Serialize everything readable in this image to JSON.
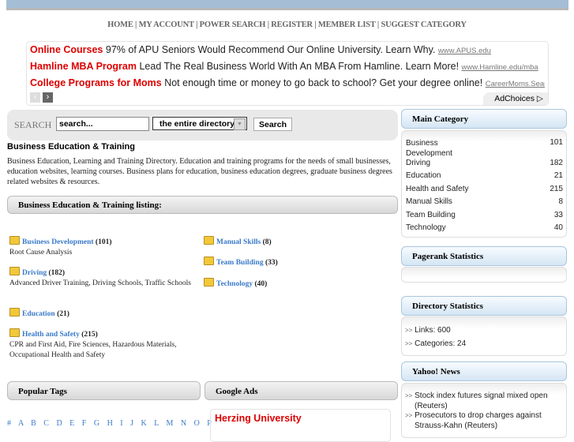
{
  "nav": [
    "HOME",
    "MY ACCOUNT",
    "POWER SEARCH",
    "REGISTER",
    "MEMBER LIST",
    "SUGGEST CATEGORY"
  ],
  "ads": [
    {
      "title": "Online Courses",
      "text": "97% of APU Seniors Would Recommend Our Online University. Learn Why.",
      "url": "www.APUS.edu"
    },
    {
      "title": "Hamline MBA Program",
      "text": "Lead The Real Business World With An MBA From Hamline. Learn More!",
      "url": "www.Hamline.edu/mba"
    },
    {
      "title": "College Programs for Moms",
      "text": "Not enough time or money to go back to school? Get your degree online!",
      "url": "CareerMoms.Search-Sch"
    }
  ],
  "adchoices": "AdChoices",
  "search": {
    "label": "SEARCH",
    "value": "search...",
    "scope": "the entire directory",
    "button": "Search"
  },
  "page": {
    "title": "Business Education & Training",
    "description": "Business Education, Learning and Training Directory. Education and training programs for the needs of small businesses, education websites, learning courses. Business plans for education, business education degrees, graduate business degrees related websites & resources.",
    "listing_header": "Business Education & Training listing:"
  },
  "listing": [
    {
      "name": "Business Development",
      "count": "(101)",
      "sub": "Root Cause Analysis"
    },
    {
      "name": "Driving",
      "count": "(182)",
      "sub": "Advanced Driver Training, Driving Schools, Traffic Schools"
    },
    {
      "name": "Education",
      "count": "(21)",
      "sub": ""
    },
    {
      "name": "Health and Safety",
      "count": "(215)",
      "sub": "CPR and First Aid, Fire Sciences, Hazardous Materials, Occupational Health and Safety"
    },
    {
      "name": "Manual Skills",
      "count": "(8)",
      "sub": ""
    },
    {
      "name": "Team Building",
      "count": "(33)",
      "sub": ""
    },
    {
      "name": "Technology",
      "count": "(40)",
      "sub": ""
    }
  ],
  "popular_tags": {
    "title": "Popular Tags",
    "letters": "# A B C D E F G H I J K L M N O P"
  },
  "google_ads": {
    "title": "Google Ads",
    "ad_title": "Herzing University"
  },
  "sidebar": {
    "main_category": {
      "title": "Main Category",
      "items": [
        {
          "name": "Business Development",
          "count": "101"
        },
        {
          "name": "Driving",
          "count": "182"
        },
        {
          "name": "Education",
          "count": "21"
        },
        {
          "name": "Health and Safety",
          "count": "215"
        },
        {
          "name": "Manual Skills",
          "count": "8"
        },
        {
          "name": "Team Building",
          "count": "33"
        },
        {
          "name": "Technology",
          "count": "40"
        }
      ]
    },
    "pagerank": {
      "title": "Pagerank Statistics"
    },
    "directory_stats": {
      "title": "Directory Statistics",
      "items": [
        "Links: 600",
        "Categories: 24"
      ]
    },
    "yahoo_news": {
      "title": "Yahoo! News",
      "items": [
        "Stock index futures signal mixed open (Reuters)",
        "Prosecutors to drop charges against Strauss-Kahn (Reuters)"
      ]
    }
  }
}
